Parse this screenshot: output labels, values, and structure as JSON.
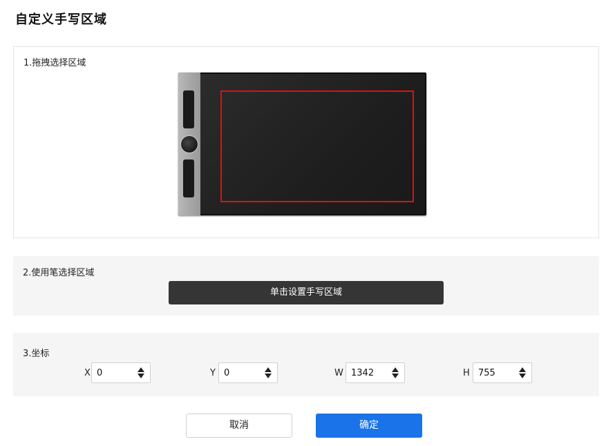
{
  "title": "自定义手写区域",
  "section1": {
    "label": "1.拖拽选择区域"
  },
  "section2": {
    "label": "2.使用笔选择区域",
    "button_label": "单击设置手写区域"
  },
  "section3": {
    "label": "3.坐标",
    "fields": [
      {
        "label": "X",
        "value": "0"
      },
      {
        "label": "Y",
        "value": "0"
      },
      {
        "label": "W",
        "value": "1342"
      },
      {
        "label": "H",
        "value": "755"
      }
    ]
  },
  "footer": {
    "cancel_label": "取消",
    "ok_label": "确定"
  },
  "colors": {
    "accent": "#1a73e8",
    "selection_border": "#e01010",
    "set_button_bg": "#353535"
  }
}
